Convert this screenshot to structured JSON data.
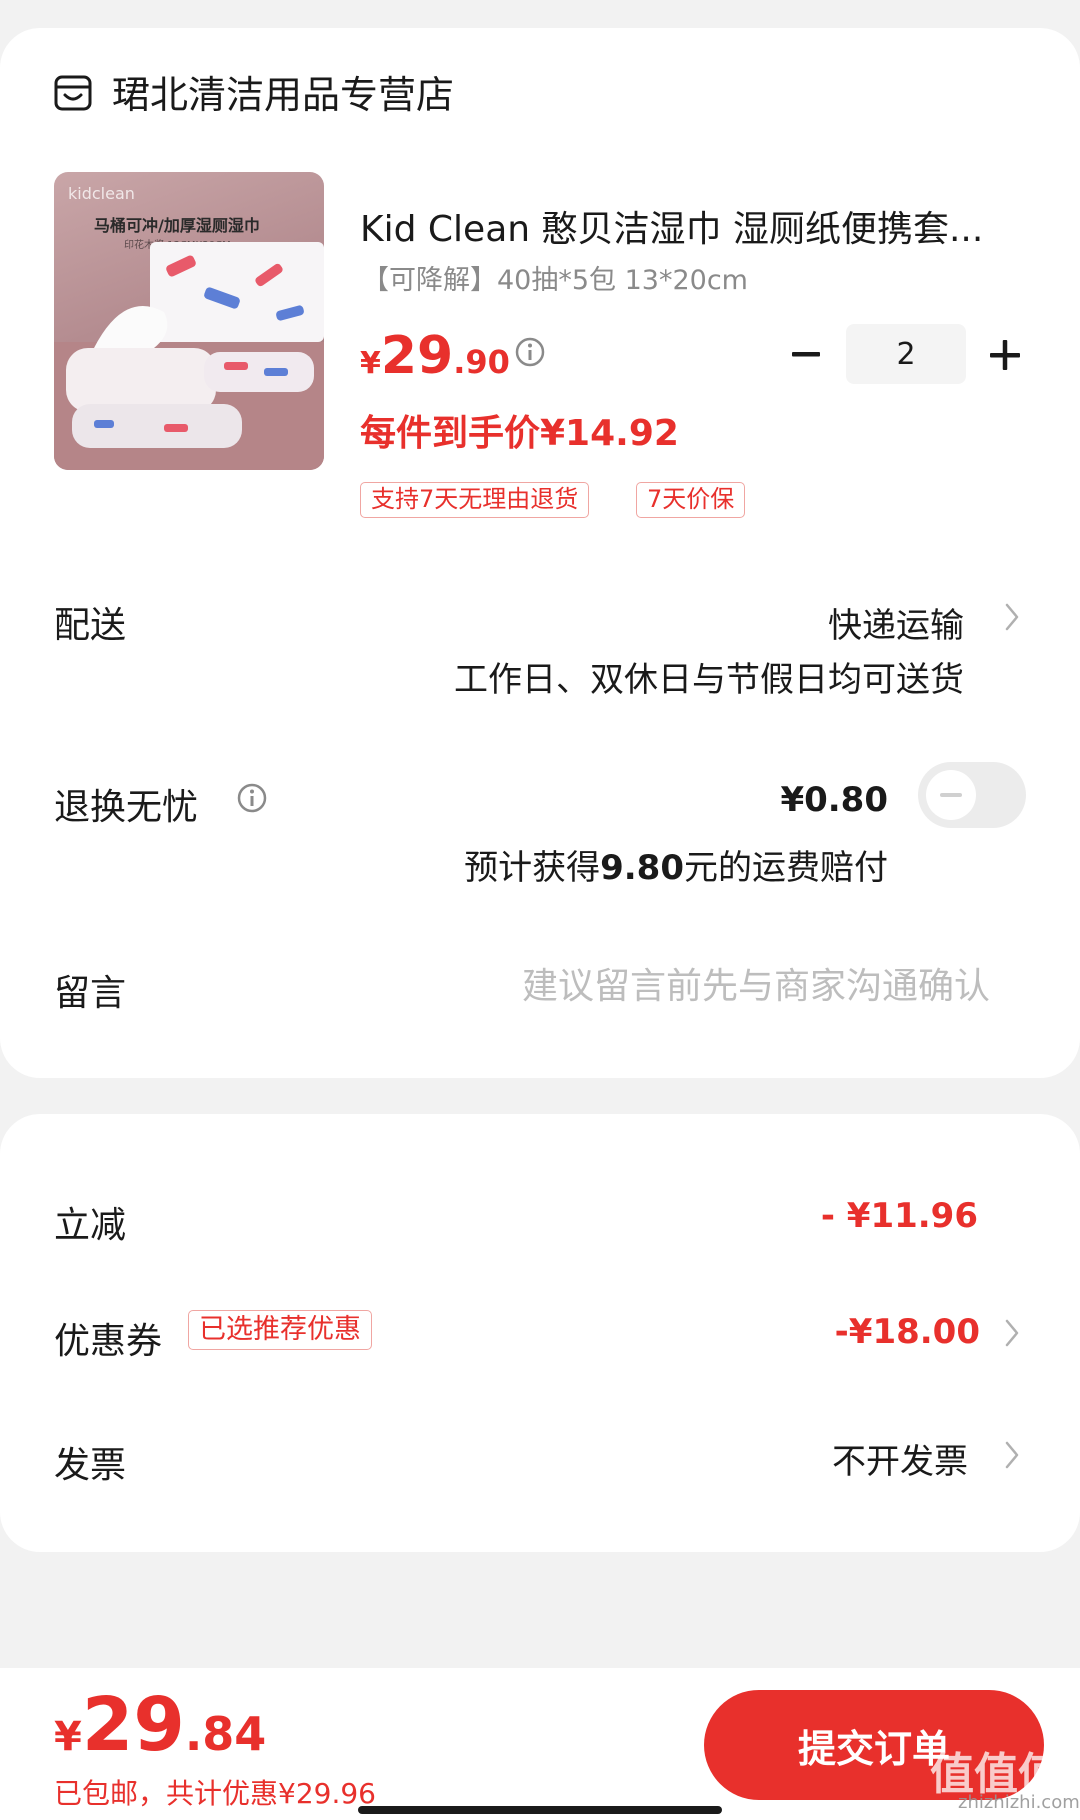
{
  "store": {
    "name": "珺北清洁用品专营店",
    "icon": "store-icon"
  },
  "product": {
    "title": "Kid Clean 憨贝洁湿巾 湿厕纸便携套...",
    "spec": "【可降解】40抽*5包 13*20cm",
    "image_brand_text": "kidclean",
    "image_title_text": "马桶可冲/加厚湿厕湿巾",
    "image_sub_text": "印花木浆 13CMX20CM",
    "price_symbol": "¥",
    "price_int": "29",
    "price_dec": ".90",
    "unit_price": "每件到手价¥14.92",
    "quantity": "2",
    "tags": [
      "支持7天无理由退货",
      "7天价保"
    ]
  },
  "delivery": {
    "label": "配送",
    "value": "快递运输",
    "note": "工作日、双休日与节假日均可送货"
  },
  "return_service": {
    "label": "退换无忧",
    "price": "¥0.80",
    "note_prefix": "预计获得",
    "note_amount": "9.80",
    "note_suffix": "元的运费赔付",
    "toggle_on": false
  },
  "message": {
    "label": "留言",
    "placeholder": "建议留言前先与商家沟通确认",
    "value": ""
  },
  "discount": {
    "label": "立减",
    "value": "- ¥11.96"
  },
  "coupon": {
    "label": "优惠券",
    "badge": "已选推荐优惠",
    "value": "-¥18.00"
  },
  "invoice": {
    "label": "发票",
    "value": "不开发票"
  },
  "footer": {
    "total_symbol": "¥",
    "total_int": "29",
    "total_dec": ".84",
    "note": "已包邮，共计优惠¥29.96",
    "submit_label": "提交订单",
    "watermark": "值值值",
    "watermark_url": "zhizhizhi.com"
  },
  "colors": {
    "accent": "#e8302c",
    "background": "#f2f2f2",
    "card": "#ffffff",
    "muted_text": "#8a8a8a",
    "placeholder": "#bdbdbd"
  }
}
